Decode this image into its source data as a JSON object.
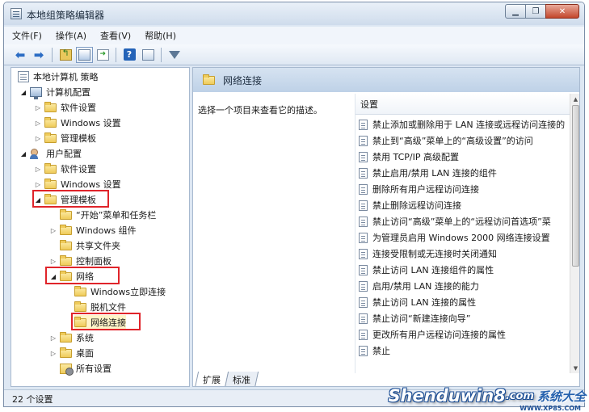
{
  "window": {
    "title": "本地组策略编辑器",
    "min_label": "▁",
    "max_label": "❐",
    "close_label": "✕"
  },
  "menu": [
    "文件(F)",
    "操作(A)",
    "查看(V)",
    "帮助(H)"
  ],
  "toolbar": {
    "icons": [
      "back-arrow-icon",
      "forward-arrow-icon",
      "up-folder-icon",
      "show-hide-tree-icon",
      "export-list-icon",
      "help-icon",
      "properties-icon",
      "filter-icon"
    ],
    "help_glyph": "?"
  },
  "tree": {
    "root": "本地计算机 策略",
    "computer_config": "计算机配置",
    "cc_software": "软件设置",
    "cc_windows": "Windows 设置",
    "cc_admin": "管理模板",
    "user_config": "用户配置",
    "uc_software": "软件设置",
    "uc_windows": "Windows 设置",
    "uc_admin": "管理模板",
    "start_menu": "“开始”菜单和任务栏",
    "win_components": "Windows 组件",
    "shared_folders": "共享文件夹",
    "control_panel": "控制面板",
    "network": "网络",
    "win_instant": "Windows立即连接",
    "offline_files": "脱机文件",
    "net_connections": "网络连接",
    "system": "系统",
    "desktop": "桌面",
    "all_settings": "所有设置"
  },
  "right": {
    "header_title": "网络连接",
    "description": "选择一个项目来查看它的描述。",
    "column_header": "设置",
    "settings": [
      "禁止添加或删除用于 LAN 连接或远程访问连接的",
      "禁止到“高级”菜单上的“高级设置”的访问",
      "禁用 TCP/IP 高级配置",
      "禁止启用/禁用 LAN 连接的组件",
      "删除所有用户远程访问连接",
      "禁止删除远程访问连接",
      "禁止访问“高级”菜单上的“远程访问首选项”菜",
      "为管理员启用 Windows 2000 网络连接设置",
      "连接受限制或无连接时关闭通知",
      "禁止访问 LAN 连接组件的属性",
      "启用/禁用 LAN 连接的能力",
      "禁止访问 LAN 连接的属性",
      "禁止访问“新建连接向导”",
      "更改所有用户远程访问连接的属性",
      "禁止"
    ],
    "tabs": [
      "扩展",
      "标准"
    ]
  },
  "status": {
    "text": "22 个设置"
  },
  "watermark": {
    "main": "Shenduwin8",
    "tld": ".com",
    "sub": "WWW.XP85.COM",
    "cn": "系统大全"
  },
  "colors": {
    "highlight_red": "#e0242a",
    "window_frame": "#7b8ea8",
    "header_blue": "#bed1e7"
  }
}
